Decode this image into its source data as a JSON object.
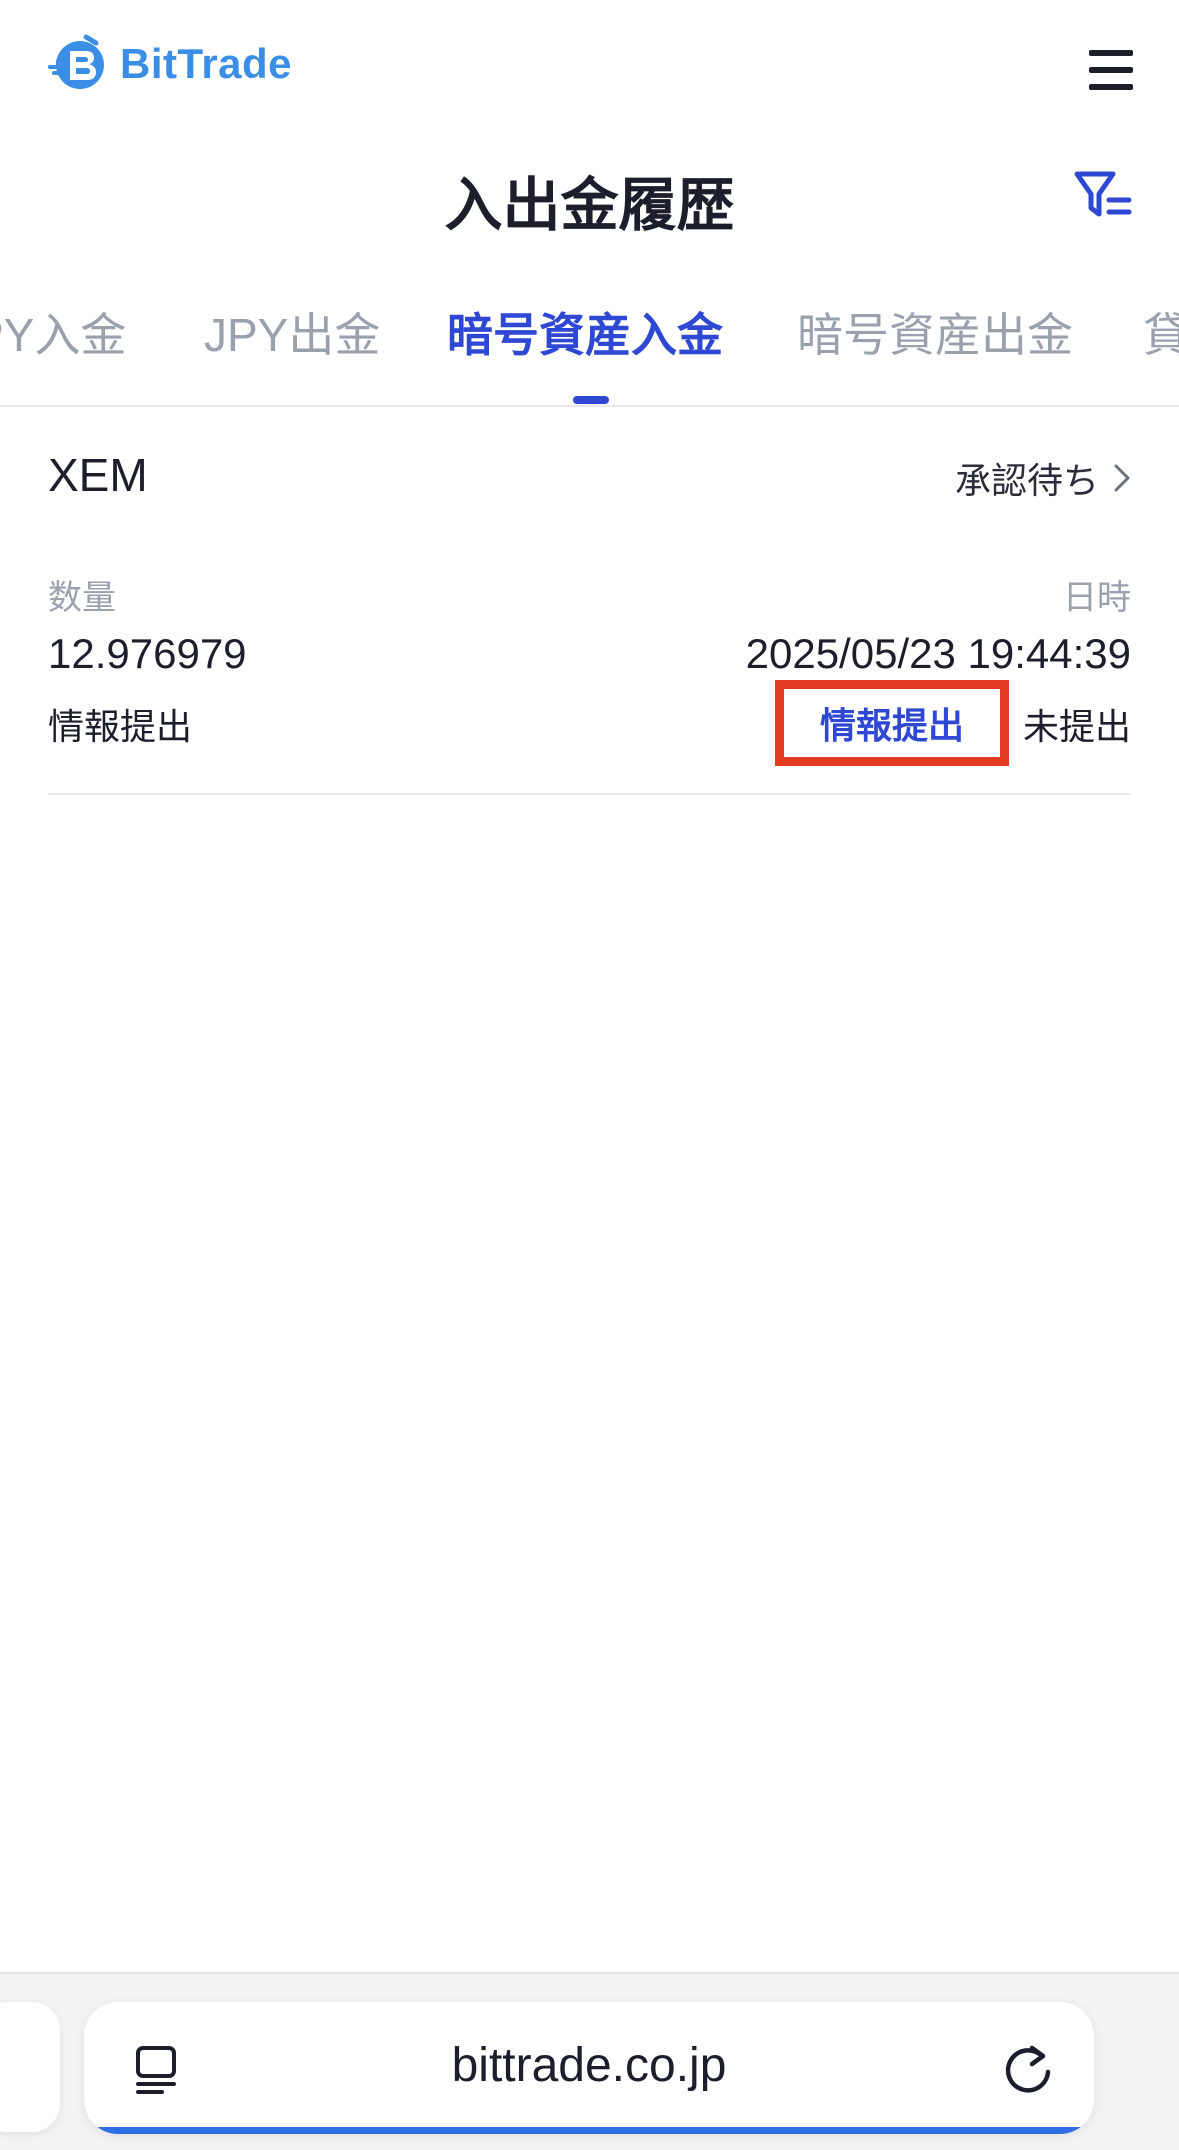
{
  "header": {
    "brand": "BitTrade",
    "menu_icon": "hamburger-menu-icon",
    "brand_color": "#3a8ee6"
  },
  "page": {
    "title": "入出金履歴",
    "filter_icon": "filter-icon"
  },
  "tabs": [
    {
      "label": "JPY入金",
      "active": false
    },
    {
      "label": "JPY出金",
      "active": false
    },
    {
      "label": "暗号資産入金",
      "active": true
    },
    {
      "label": "暗号資産出金",
      "active": false
    },
    {
      "label": "貸",
      "active": false
    }
  ],
  "record": {
    "coin": "XEM",
    "status": "承認待ち",
    "amount_label": "数量",
    "date_label": "日時",
    "amount": "12.976979",
    "datetime": "2025/05/23 19:44:39",
    "info_label": "情報提出",
    "submit_link": "情報提出",
    "submit_state": "未提出"
  },
  "browser": {
    "url": "bittrade.co.jp",
    "accent": "#2f6fe4"
  },
  "colors": {
    "accent": "#2f48d4",
    "highlight_box": "#e23b22",
    "muted": "#9aa1ad"
  }
}
